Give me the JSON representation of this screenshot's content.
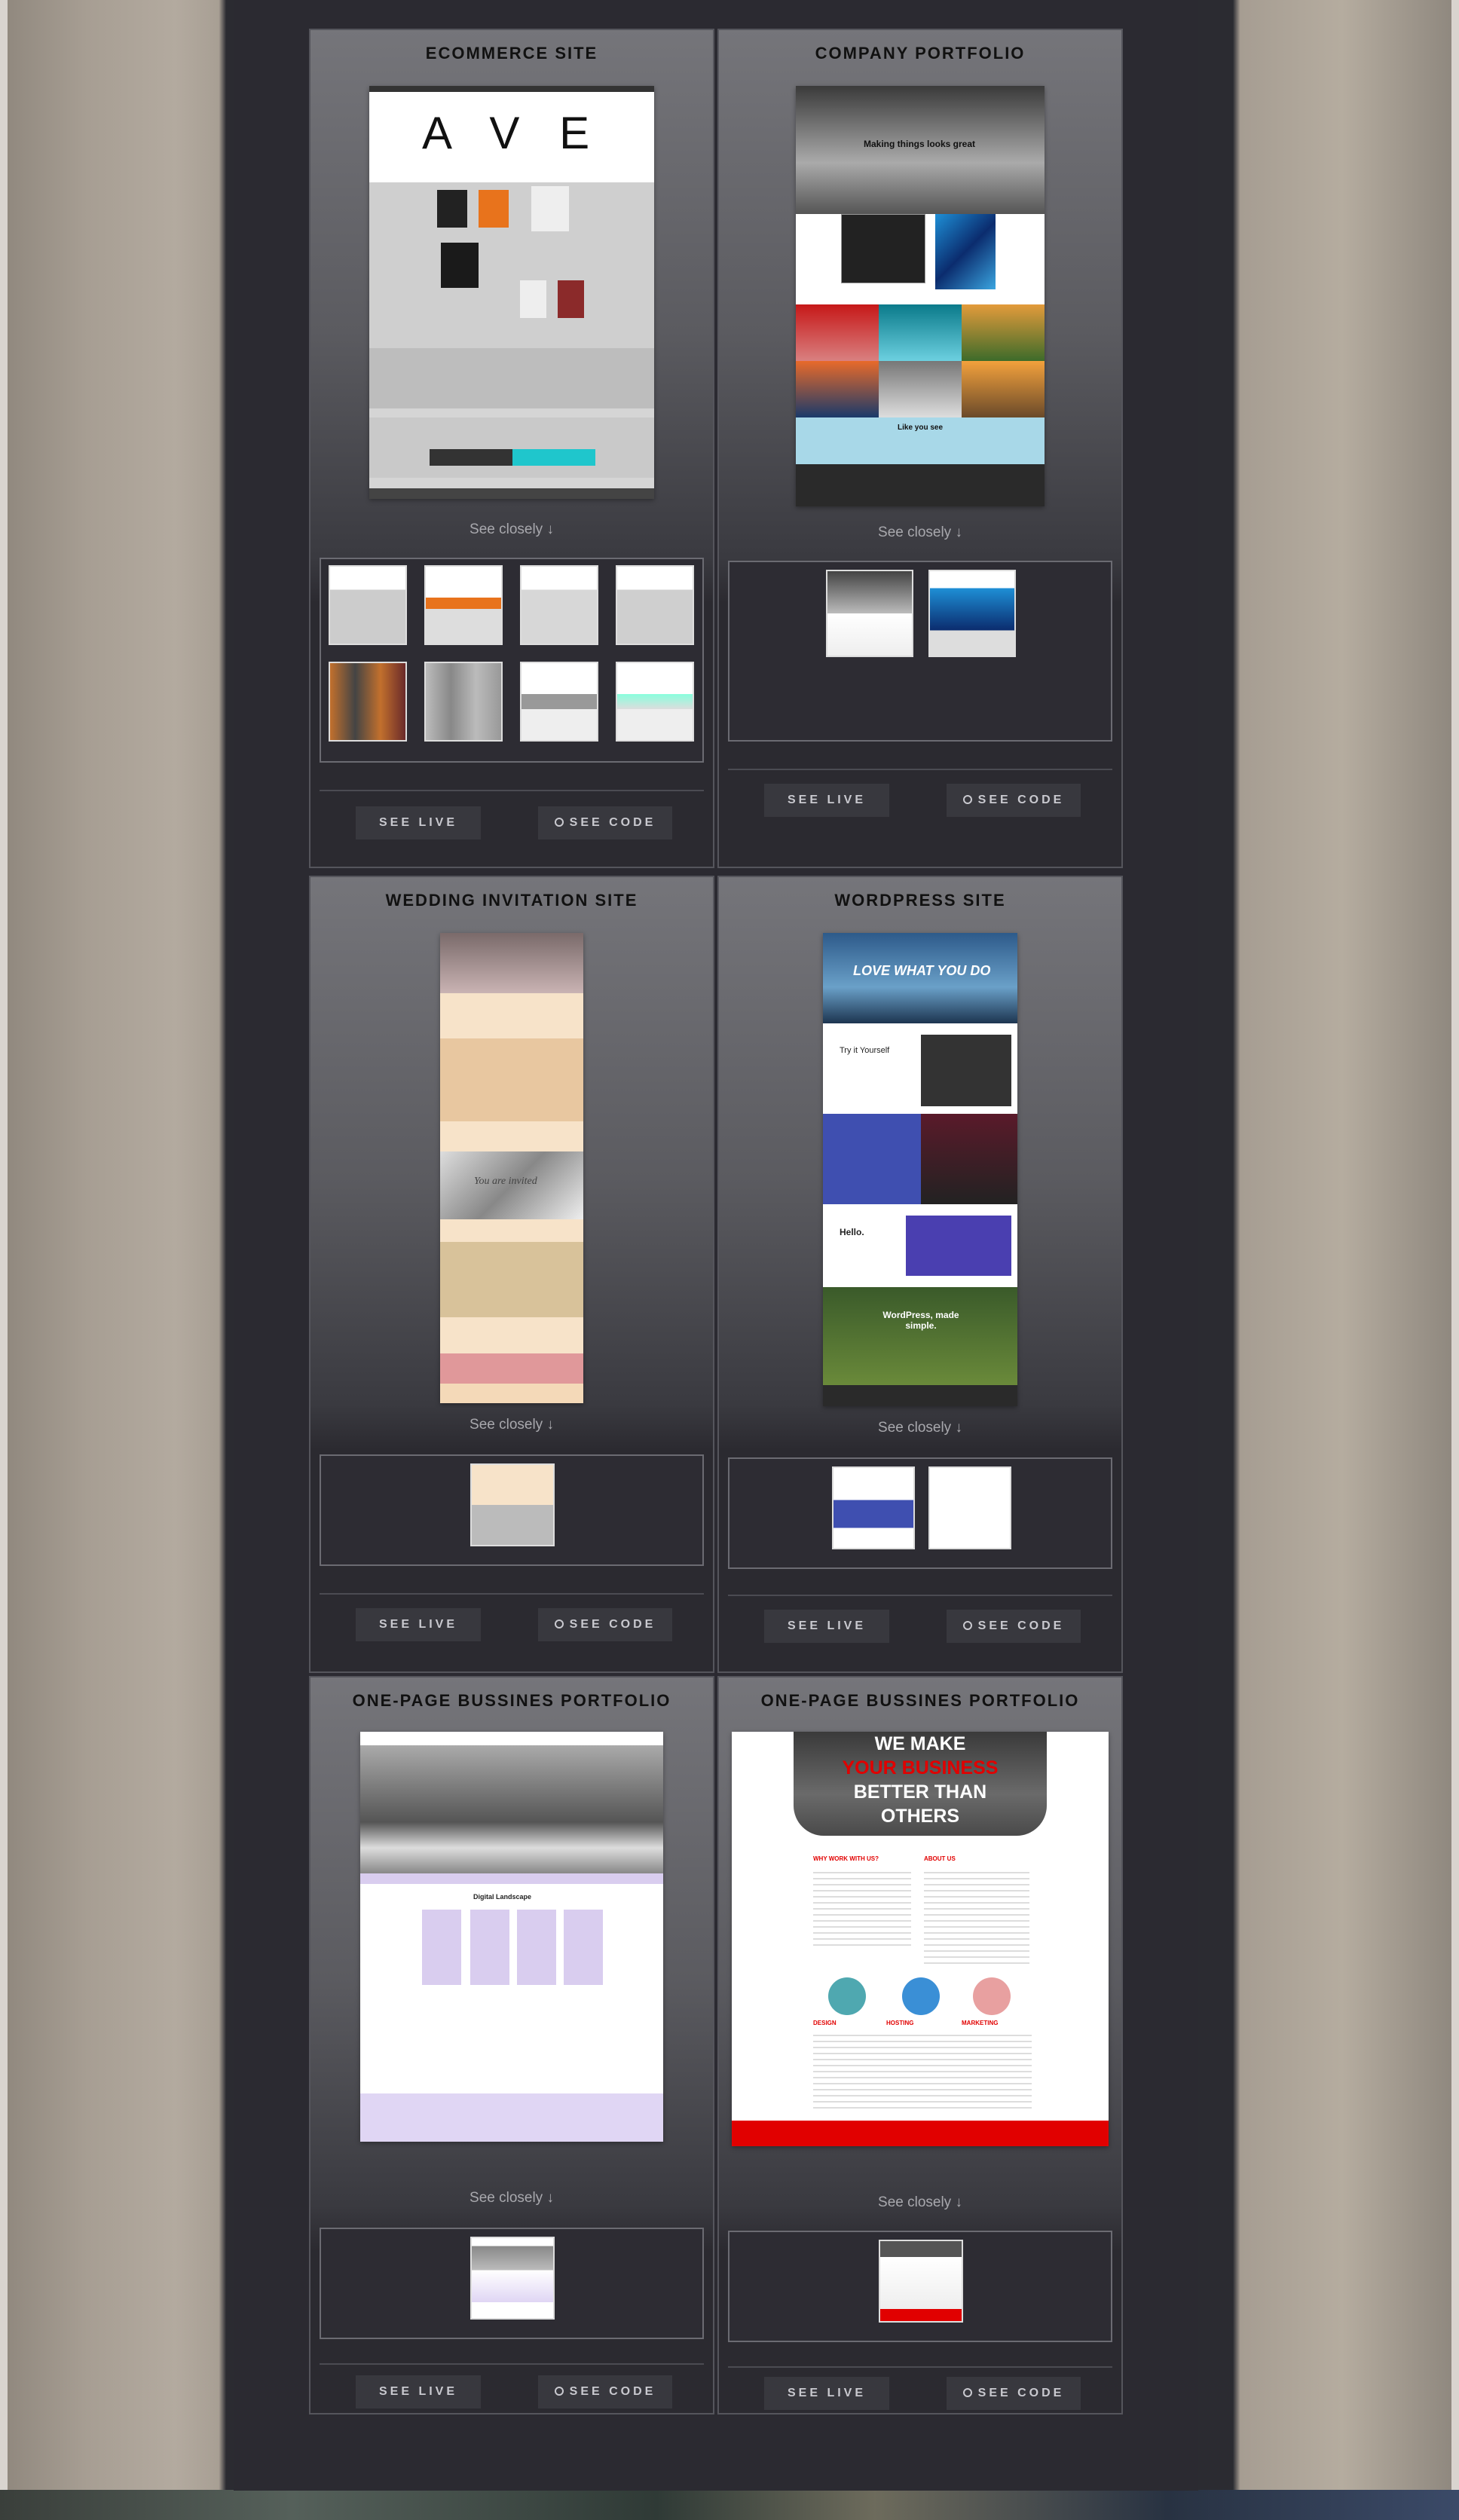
{
  "cards": [
    {
      "title": "ECOMMERCE SITE",
      "see_closely": "See closely ↓",
      "preview_brand": "A V E",
      "see_live": "SEE LIVE",
      "see_code": "SEE CODE"
    },
    {
      "title": "COMPANY PORTFOLIO",
      "see_closely": "See closely ↓",
      "preview_headline": "Making things looks great",
      "preview_sub": "Like you see",
      "see_live": "SEE LIVE",
      "see_code": "SEE CODE"
    },
    {
      "title": "WEDDING INVITATION SITE",
      "see_closely": "See closely ↓",
      "preview_headline": "You are invited",
      "see_live": "SEE LIVE",
      "see_code": "SEE CODE"
    },
    {
      "title": "WORDPRESS SITE",
      "see_closely": "See closely ↓",
      "preview_headline": "LOVE WHAT YOU DO",
      "preview_try": "Try it Yourself",
      "preview_hello": "Hello.",
      "preview_wp": "WordPress, made simple.",
      "see_live": "SEE LIVE",
      "see_code": "SEE CODE"
    },
    {
      "title": "ONE-PAGE BUSSINES PORTFOLIO",
      "see_closely": "See closely ↓",
      "preview_brand": "Digital Landscape",
      "see_live": "SEE LIVE",
      "see_code": "SEE CODE"
    },
    {
      "title": "ONE-PAGE BUSSINES PORTFOLIO",
      "see_closely": "See closely ↓",
      "preview_line1": "WE MAKE",
      "preview_line2": "YOUR BUSINESS",
      "preview_line3": "BETTER THAN",
      "preview_line4": "OTHERS",
      "preview_why": "WHY WORK WITH US?",
      "preview_about": "ABOUT US",
      "preview_design": "DESIGN",
      "preview_hosting": "HOSTING",
      "preview_marketing": "MARKETING",
      "see_live": "SEE LIVE",
      "see_code": "SEE CODE"
    }
  ],
  "colors": {
    "container_bg": "#2b2a31",
    "button_bg": "#38383e",
    "accent_red": "#e10000",
    "accent_teal": "#1fc6cc"
  }
}
